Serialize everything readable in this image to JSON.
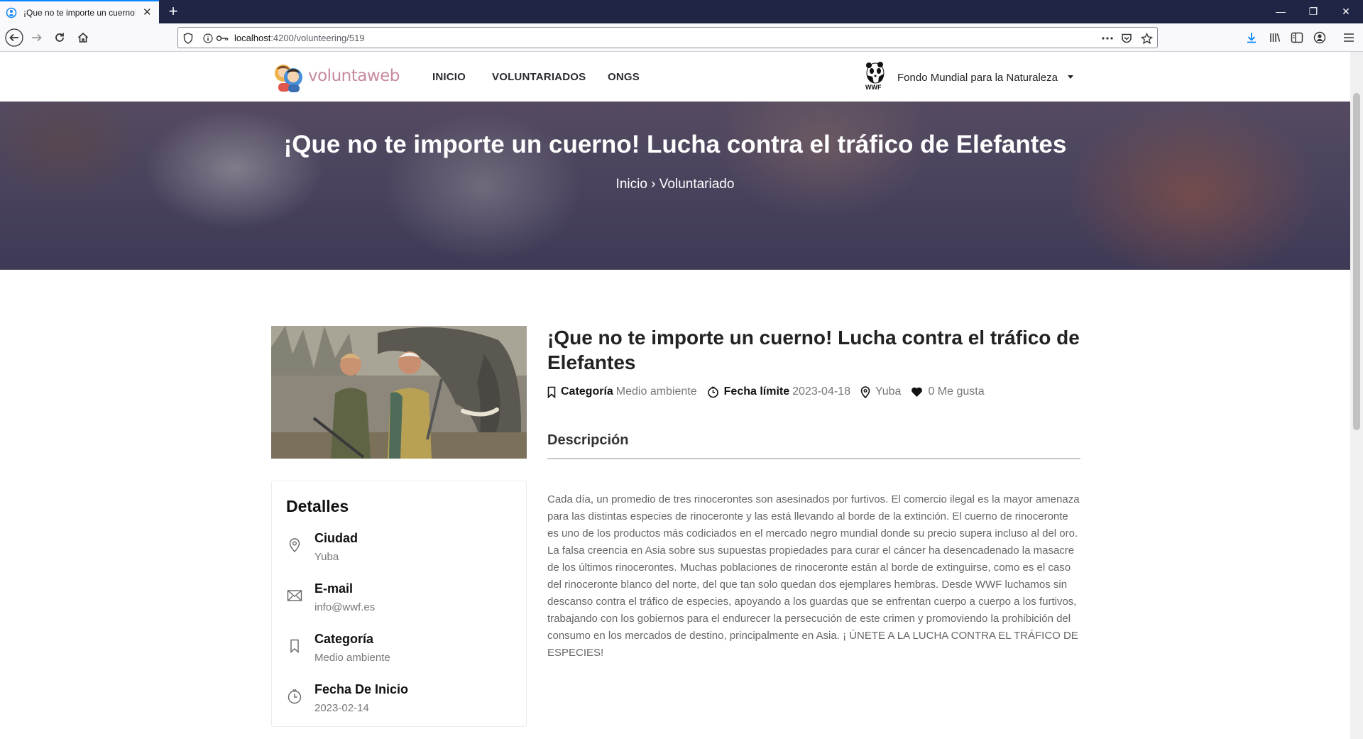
{
  "browser": {
    "tab_title": "¡Que no te importe un cuerno! Lucha contra el tráfico de Elefantes",
    "url_host": "localhost",
    "url_path": ":4200/volunteering/519"
  },
  "header": {
    "logo_text": "voluntaweb",
    "menu": [
      "INICIO",
      "VOLUNTARIADOS",
      "ONGS"
    ],
    "org_logo_text": "WWF",
    "org_name": "Fondo Mundial para la Naturaleza"
  },
  "hero": {
    "title": "¡Que no te importe un cuerno! Lucha contra el tráfico de Elefantes",
    "breadcrumb": "Inicio › Voluntariado"
  },
  "volunteering": {
    "title": "¡Que no te importe un cuerno! Lucha contra el tráfico de Elefantes",
    "category_label": "Categoría",
    "category_value": "Medio ambiente",
    "deadline_label": "Fecha límite",
    "deadline_value": "2023-04-18",
    "location": "Yuba",
    "likes": "0 Me gusta",
    "description_heading": "Descripción",
    "description": "Cada día, un promedio de tres rinocerontes son asesinados por furtivos. El comercio ilegal es la mayor amenaza para las distintas especies de rinoceronte y las está llevando al borde de la extinción. El cuerno de rinoceronte es uno de los productos más codiciados en el mercado negro mundial donde su precio supera incluso al del oro. La falsa creencia en Asia sobre sus supuestas propiedades para curar el cáncer ha desencadenado la masacre de los últimos rinocerontes. Muchas poblaciones de rinoceronte están al borde de extinguirse, como es el caso del rinoceronte blanco del norte, del que tan solo quedan dos ejemplares hembras. Desde WWF luchamos sin descanso contra el tráfico de especies, apoyando a los guardas que se enfrentan cuerpo a cuerpo a los furtivos, trabajando con los gobiernos para el endurecer la persecución de este crimen y promoviendo la prohibición del consumo en los mercados de destino, principalmente en Asia. ¡ ÚNETE A LA LUCHA CONTRA EL TRÁFICO DE ESPECIES!"
  },
  "details": {
    "title": "Detalles",
    "rows": [
      {
        "label": "Ciudad",
        "value": "Yuba",
        "icon": "map-pin-icon"
      },
      {
        "label": "E-mail",
        "value": "info@wwf.es",
        "icon": "mail-icon"
      },
      {
        "label": "Categoría",
        "value": "Medio ambiente",
        "icon": "bookmark-icon"
      },
      {
        "label": "Fecha De Inicio",
        "value": "2023-02-14",
        "icon": "clock-icon"
      }
    ]
  }
}
